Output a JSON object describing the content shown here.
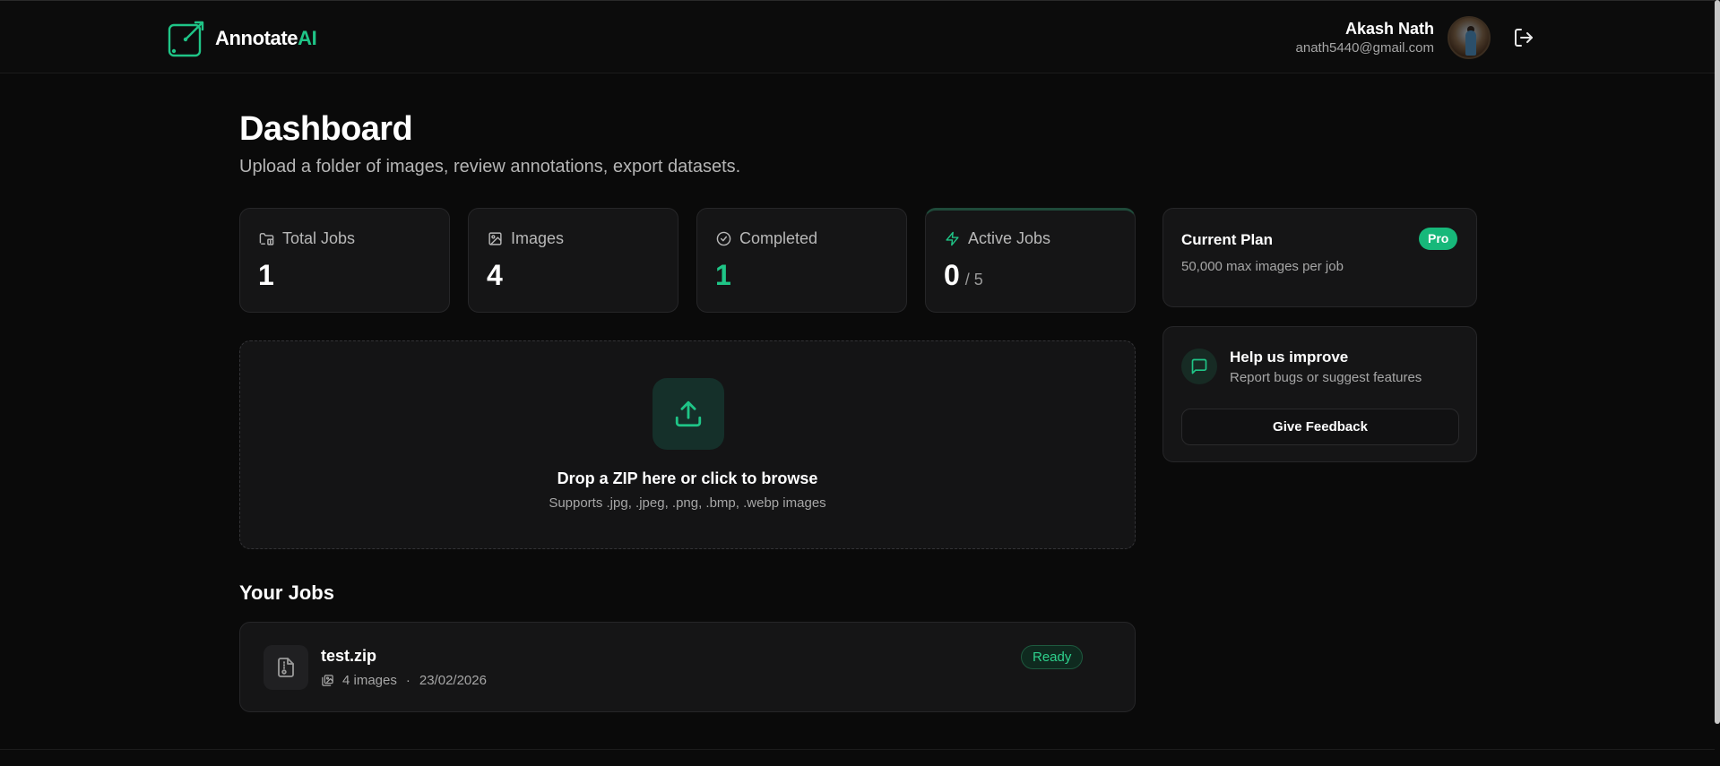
{
  "app": {
    "logo_main": "Annotate",
    "logo_accent": "AI"
  },
  "user": {
    "name": "Akash Nath",
    "email": "anath5440@gmail.com"
  },
  "page": {
    "title": "Dashboard",
    "subtitle": "Upload a folder of images, review annotations, export datasets."
  },
  "stats": {
    "total_jobs": {
      "label": "Total Jobs",
      "value": "1",
      "icon": "folder-icon"
    },
    "images": {
      "label": "Images",
      "value": "4",
      "icon": "image-icon"
    },
    "completed": {
      "label": "Completed",
      "value": "1",
      "icon": "check-circle-icon"
    },
    "active_jobs": {
      "label": "Active Jobs",
      "value": "0",
      "max": "/ 5",
      "icon": "zap-icon"
    }
  },
  "upload": {
    "title": "Drop a ZIP here or click to browse",
    "subtitle": "Supports .jpg, .jpeg, .png, .bmp, .webp images"
  },
  "jobs": {
    "heading": "Your Jobs",
    "items": [
      {
        "name": "test.zip",
        "images": "4 images",
        "date": "23/02/2026",
        "status": "Ready"
      }
    ]
  },
  "plan": {
    "title": "Current Plan",
    "badge": "Pro",
    "description": "50,000 max images per job"
  },
  "feedback": {
    "title": "Help us improve",
    "subtitle": "Report bugs or suggest features",
    "button": "Give Feedback"
  },
  "colors": {
    "accent": "#1fc587",
    "background": "#0a0a0a",
    "card": "#151516"
  }
}
